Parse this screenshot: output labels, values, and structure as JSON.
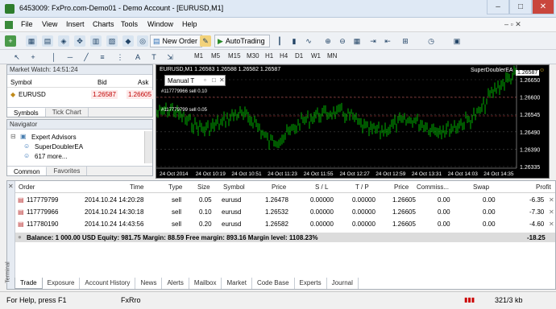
{
  "window": {
    "title": "6453009: FxPro.com-Demo01 - Demo Account - [EURUSD,M1]",
    "minimize": "–",
    "maximize": "□",
    "close": "✕"
  },
  "menu": [
    "File",
    "View",
    "Insert",
    "Charts",
    "Tools",
    "Window",
    "Help"
  ],
  "toolbar": {
    "new_order": "New Order",
    "autotrading": "AutoTrading"
  },
  "timeframes": [
    "M1",
    "M5",
    "M15",
    "M30",
    "H1",
    "H4",
    "D1",
    "W1",
    "MN"
  ],
  "market_watch": {
    "header": "Market Watch: 14:51:24",
    "columns": [
      "Symbol",
      "Bid",
      "Ask"
    ],
    "rows": [
      {
        "symbol": "EURUSD",
        "bid": "1.26587",
        "ask": "1.26605"
      }
    ],
    "tabs": [
      "Symbols",
      "Tick Chart"
    ]
  },
  "navigator": {
    "header": "Navigator",
    "items": [
      "Expert Advisors",
      "SuperDoublerEA",
      "617 more..."
    ],
    "tabs": [
      "Common",
      "Favorites"
    ]
  },
  "chart": {
    "header": "EURUSD,M1  1.26583 1.26588 1.26582 1.26587",
    "ea_label": "SuperDoublerEA",
    "panel_title": "Manual T",
    "trade_labels": [
      "#117779966 sell 0.10",
      "#117779799 sell 0.05"
    ],
    "current_price": "1.26587",
    "price_labels": [
      "1.26650",
      "1.26600",
      "1.26545",
      "1.26490",
      "1.26390",
      "1.26335"
    ],
    "time_labels": [
      "24 Oct 2014",
      "24 Oct 10:19",
      "24 Oct 10:51",
      "24 Oct 11:23",
      "24 Oct 11:55",
      "24 Oct 12:27",
      "24 Oct 12:59",
      "24 Oct 13:31",
      "24 Oct 14:03",
      "24 Oct 14:35"
    ]
  },
  "terminal": {
    "side_label": "Terminal",
    "columns": [
      "Order",
      "Time",
      "Type",
      "Size",
      "Symbol",
      "Price",
      "S / L",
      "T / P",
      "Price",
      "Commiss...",
      "Swap",
      "Profit"
    ],
    "orders": [
      {
        "order": "117779799",
        "time": "2014.10.24 14:20:28",
        "type": "sell",
        "size": "0.05",
        "symbol": "eurusd",
        "price": "1.26478",
        "sl": "0.00000",
        "tp": "0.00000",
        "cur": "1.26605",
        "comm": "0.00",
        "swap": "0.00",
        "profit": "-6.35"
      },
      {
        "order": "117779966",
        "time": "2014.10.24 14:30:18",
        "type": "sell",
        "size": "0.10",
        "symbol": "eurusd",
        "price": "1.26532",
        "sl": "0.00000",
        "tp": "0.00000",
        "cur": "1.26605",
        "comm": "0.00",
        "swap": "0.00",
        "profit": "-7.30"
      },
      {
        "order": "117780190",
        "time": "2014.10.24 14:43:56",
        "type": "sell",
        "size": "0.20",
        "symbol": "eurusd",
        "price": "1.26582",
        "sl": "0.00000",
        "tp": "0.00000",
        "cur": "1.26605",
        "comm": "0.00",
        "swap": "0.00",
        "profit": "-4.60"
      }
    ],
    "balance_line": "Balance: 1 000.00 USD  Equity: 981.75  Margin: 88.59  Free margin: 893.16  Margin level: 1108.23%",
    "total_profit": "-18.25",
    "tabs": [
      "Trade",
      "Exposure",
      "Account History",
      "News",
      "Alerts",
      "Mailbox",
      "Market",
      "Code Base",
      "Experts",
      "Journal"
    ]
  },
  "status": {
    "help": "For Help, press F1",
    "profile": "FxRro",
    "traffic": "321/3 kb"
  },
  "colors": {
    "chart_bg": "#000000",
    "candle": "#00b000",
    "bid": "#c00000",
    "ask": "#c00000",
    "grid": "#4a4a4a"
  }
}
